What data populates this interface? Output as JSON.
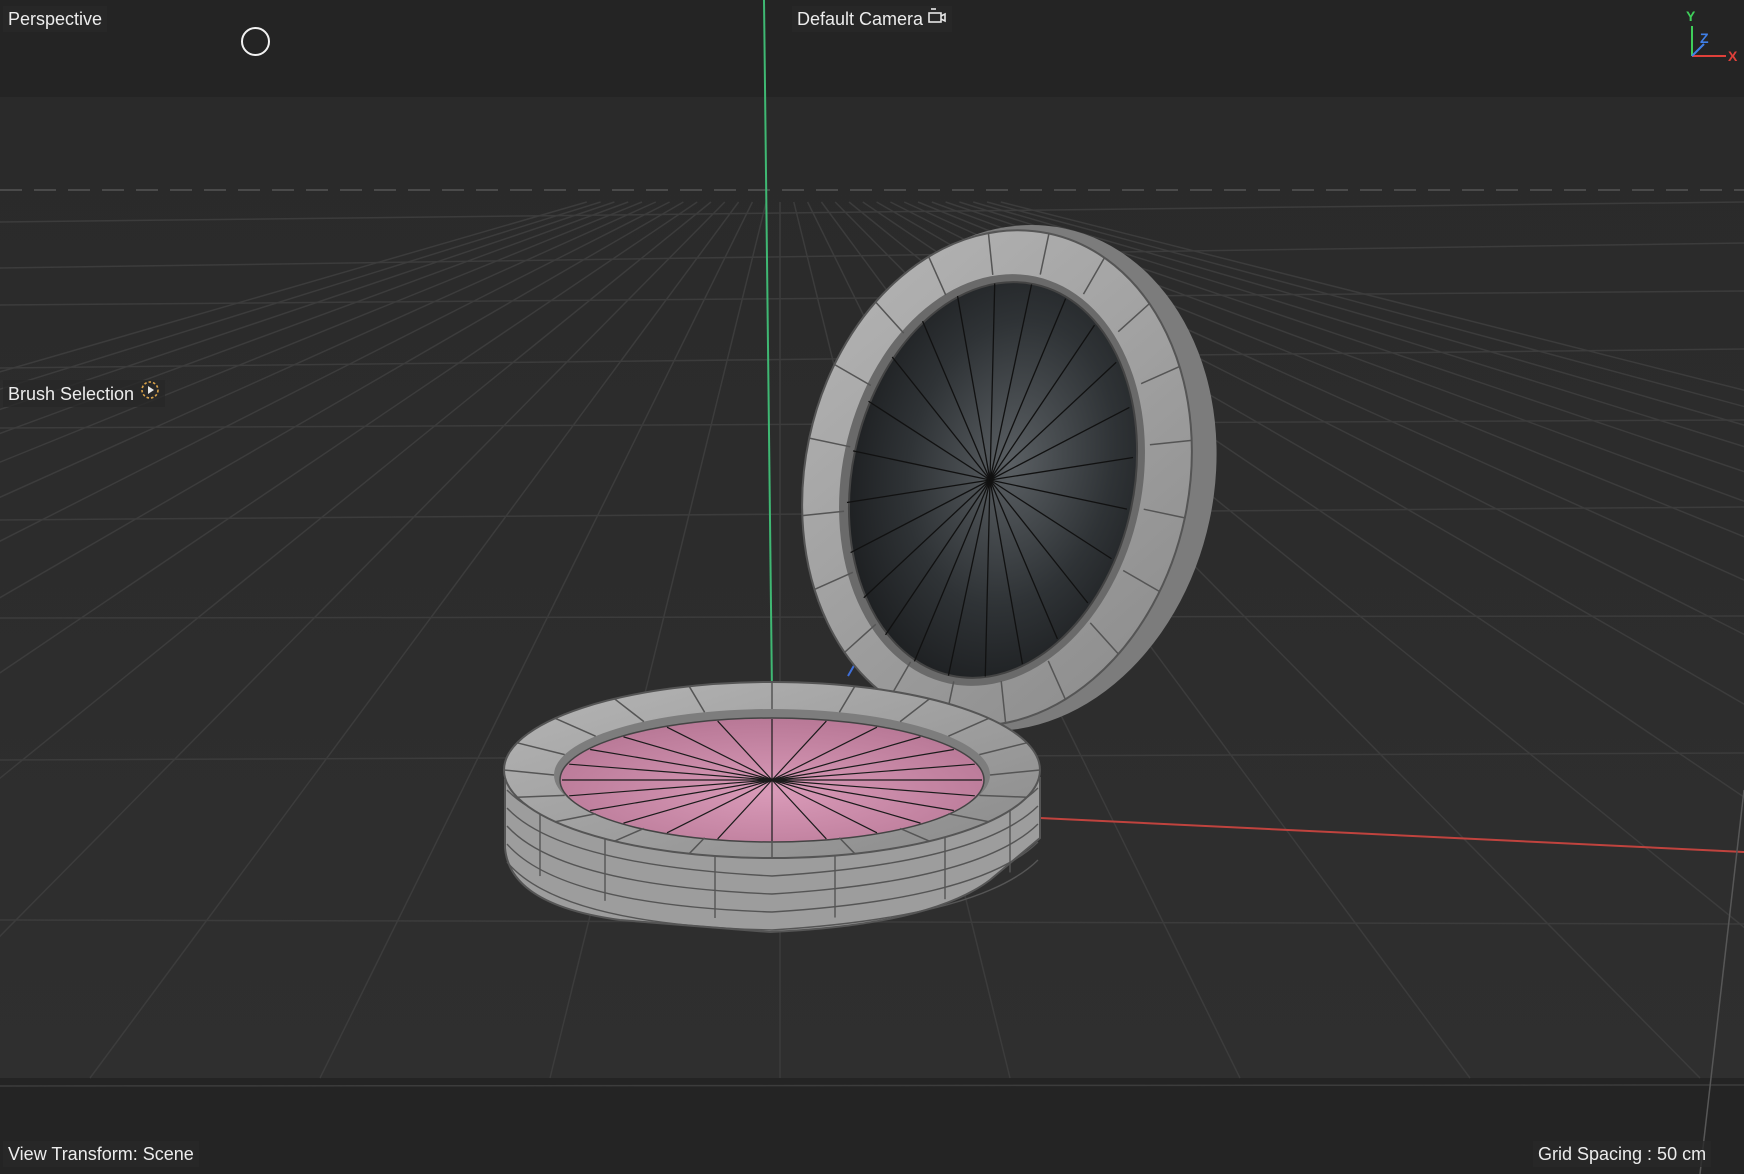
{
  "viewport": {
    "view_name": "Perspective",
    "camera_label": "Default Camera",
    "camera_icon": "camera-icon",
    "tool_label": "Brush Selection",
    "tool_icon": "brush-selection-icon",
    "view_transform": "View Transform: Scene",
    "grid_spacing": "Grid Spacing : 50 cm",
    "cursor_icon": "brush-cursor-icon"
  },
  "axis_gizmo": {
    "y_label": "Y",
    "z_label": "Z",
    "x_label": "X",
    "colors": {
      "x": "#e0403a",
      "y": "#3fcf5a",
      "z": "#3f7fe8"
    }
  },
  "colors": {
    "viewport_bg": "#2b2b2b",
    "band_bg": "#242424",
    "grid_line": "#3d3d3d",
    "world_x_axis": "#c0433e",
    "world_y_axis": "#3fb873",
    "model_gray": "#a9a9a9",
    "blush_pink": "#c98aa8"
  }
}
